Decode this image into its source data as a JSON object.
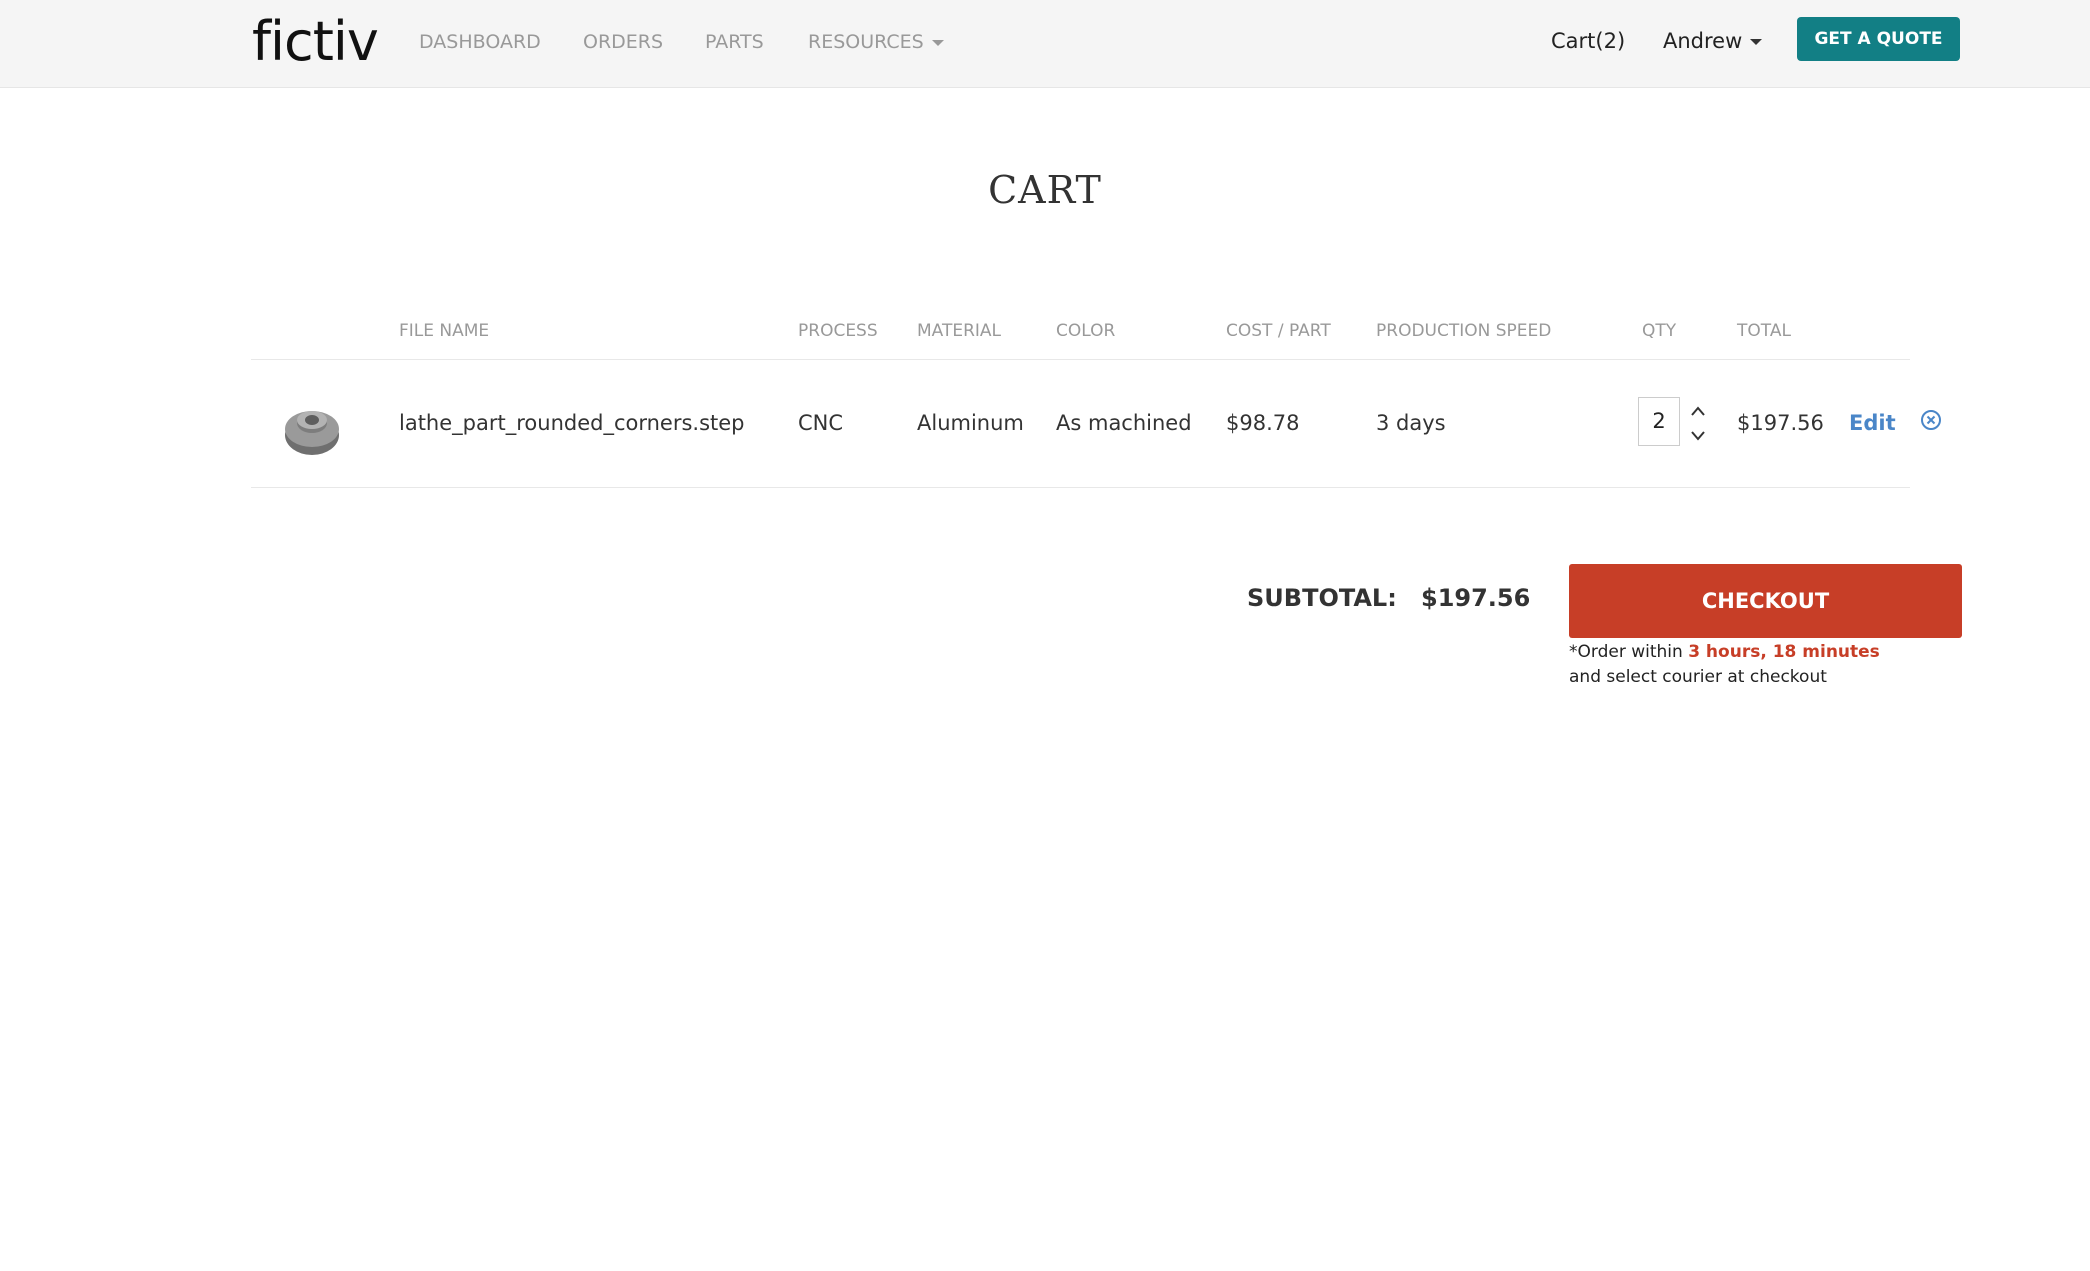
{
  "header": {
    "logo": "fictiv",
    "nav": [
      {
        "label": "DASHBOARD"
      },
      {
        "label": "ORDERS"
      },
      {
        "label": "PARTS"
      },
      {
        "label": "RESOURCES"
      }
    ],
    "cart_label": "Cart(2)",
    "user_name": "Andrew",
    "quote_button": "GET A QUOTE",
    "colors": {
      "bar_bg": "#f5f5f5",
      "quote_bg": "#127f85"
    }
  },
  "page_title": "CART",
  "table": {
    "columns": [
      "FILE NAME",
      "PROCESS",
      "MATERIAL",
      "COLOR",
      "COST / PART",
      "PRODUCTION SPEED",
      "QTY",
      "TOTAL"
    ],
    "rows": [
      {
        "thumbnail_icon": "cnc-part-thumbnail",
        "file_name": "lathe_part_rounded_corners.step",
        "process": "CNC",
        "material": "Aluminum",
        "color": "As machined",
        "cost_per_part": "$98.78",
        "production_speed": "3 days",
        "qty": "2",
        "total": "$197.56",
        "edit_label": "Edit",
        "remove_icon": "remove-circle-icon"
      }
    ]
  },
  "summary": {
    "subtotal_label": "SUBTOTAL:",
    "subtotal_value": "$197.56",
    "checkout_label": "CHECKOUT",
    "notice_prefix": "*Order within ",
    "notice_time": "3 hours, 18 minutes",
    "notice_suffix": "and select courier at checkout",
    "colors": {
      "checkout_bg": "#c73e27",
      "edit_link": "#4a86c8"
    }
  }
}
